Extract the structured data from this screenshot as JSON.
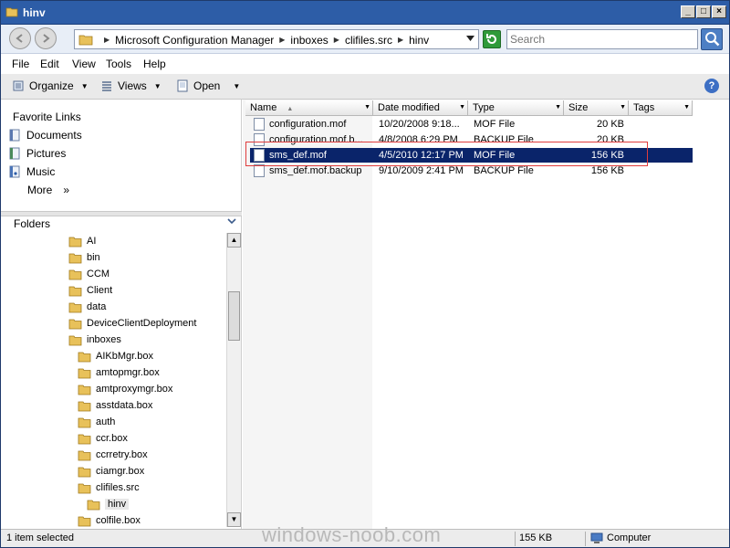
{
  "window": {
    "title": "hinv"
  },
  "address": {
    "crumbs": [
      "Microsoft Configuration Manager",
      "inboxes",
      "clifiles.src",
      "hinv"
    ],
    "search_placeholder": "Search"
  },
  "menu": {
    "items": [
      "File",
      "Edit",
      "View",
      "Tools",
      "Help"
    ]
  },
  "toolbar": {
    "organize": "Organize",
    "views": "Views",
    "open": "Open",
    "help_glyph": "?"
  },
  "favorites": {
    "title": "Favorite Links",
    "items": [
      "Documents",
      "Pictures",
      "Music",
      "More"
    ],
    "more_glyph": "»"
  },
  "folders": {
    "title": "Folders",
    "tree": [
      "AI",
      "bin",
      "CCM",
      "Client",
      "data",
      "DeviceClientDeployment",
      "inboxes",
      "AIKbMgr.box",
      "amtopmgr.box",
      "amtproxymgr.box",
      "asstdata.box",
      "auth",
      "ccr.box",
      "ccrretry.box",
      "ciamgr.box",
      "clifiles.src",
      "hinv",
      "colfile.box"
    ]
  },
  "columns": [
    "Name",
    "Date modified",
    "Type",
    "Size",
    "Tags"
  ],
  "files": [
    {
      "name": "configuration.mof",
      "date": "10/20/2008 9:18...",
      "type": "MOF File",
      "size": "20 KB"
    },
    {
      "name": "configuration.mof.b...",
      "date": "4/8/2008 6:29 PM",
      "type": "BACKUP File",
      "size": "20 KB"
    },
    {
      "name": "sms_def.mof",
      "date": "4/5/2010 12:17 PM",
      "type": "MOF File",
      "size": "156 KB"
    },
    {
      "name": "sms_def.mof.backup",
      "date": "9/10/2009 2:41 PM",
      "type": "BACKUP File",
      "size": "156 KB"
    }
  ],
  "status": {
    "selected": "1 item selected",
    "size": "155 KB",
    "location": "Computer"
  },
  "watermark": "windows-noob.com",
  "colors": {
    "titlebar": "#2d5da7",
    "selection": "#0a246a",
    "highlight_box": "#e03c3c",
    "folder": "#e8c15a"
  }
}
